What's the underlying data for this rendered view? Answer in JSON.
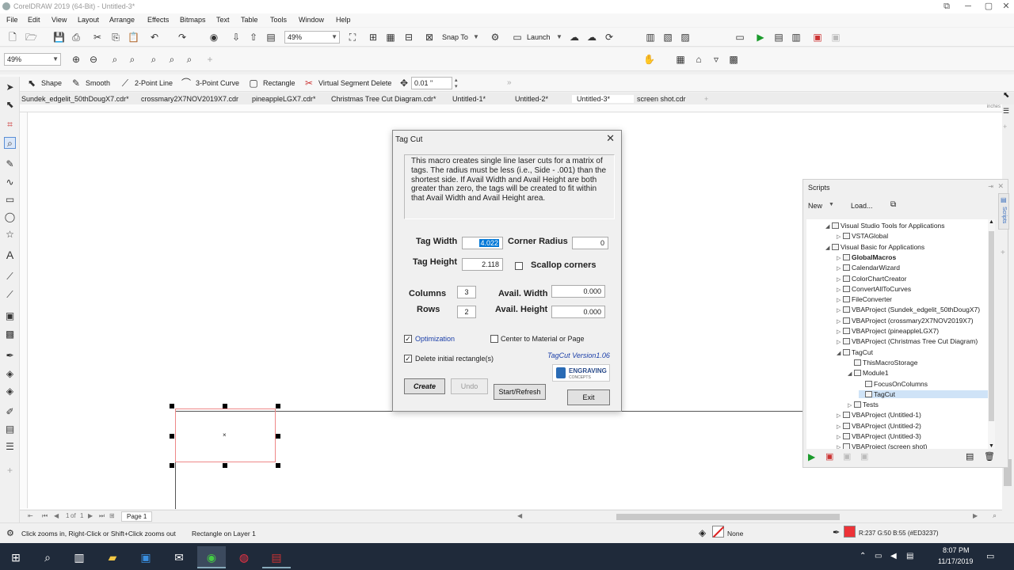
{
  "window": {
    "title": "CorelDRAW 2019 (64-Bit) - Untitled-3*"
  },
  "menu": [
    "File",
    "Edit",
    "View",
    "Layout",
    "Arrange",
    "Effects",
    "Bitmaps",
    "Text",
    "Table",
    "Tools",
    "Window",
    "Help"
  ],
  "standard_toolbar": {
    "zoom": "49%",
    "snap_to": "Snap To",
    "launch": "Launch"
  },
  "property_bar": {
    "zoom": "49%"
  },
  "node_bar": {
    "shape": "Shape",
    "smooth": "Smooth",
    "two_point_line": "2-Point Line",
    "three_point_curve": "3-Point Curve",
    "rectangle": "Rectangle",
    "virtual_segment_delete": "Virtual Segment Delete",
    "nudge": "0.01 \""
  },
  "doc_tabs": [
    "Sundek_edgelit_50thDougX7.cdr*",
    "crossmary2X7NOV2019X7.cdr",
    "pineappleLGX7.cdr*",
    "Christmas Tree Cut Diagram.cdr*",
    "Untitled-1*",
    "Untitled-2*",
    "Untitled-3*",
    "screen shot.cdr"
  ],
  "ruler_unit": "inches",
  "dialog": {
    "title": "Tag Cut",
    "description": "This macro creates single line laser cuts for a matrix of tags.  The radius must be less (i.e., Side - .001) than the shortest side.                                                    If Avail Width and Avail Height are both greater than zero, the tags will be created to fit within that Avail Width and Avail Height area.",
    "tag_width_label": "Tag Width",
    "tag_width_value": "4.022",
    "corner_radius_label": "Corner Radius",
    "corner_radius_value": "0",
    "tag_height_label": "Tag Height",
    "tag_height_value": "2.118",
    "scallop_label": "Scallop corners",
    "columns_label": "Columns",
    "columns_value": "3",
    "rows_label": "Rows",
    "rows_value": "2",
    "avail_width_label": "Avail. Width",
    "avail_width_value": "0.000",
    "avail_height_label": "Avail. Height",
    "avail_height_value": "0.000",
    "optimization_label": "Optimization",
    "center_label": "Center to Material or Page",
    "delete_label": "Delete initial rectangle(s)",
    "version": "TagCut Version1.06",
    "logo_text": "ENGRAVING",
    "logo_sub": "CONCEPTS",
    "create": "Create",
    "undo": "Undo",
    "start_refresh": "Start/Refresh",
    "exit": "Exit"
  },
  "scripts": {
    "title": "Scripts",
    "new": "New",
    "load": "Load...",
    "tab": "Scripts",
    "tree": [
      {
        "label": "Visual Studio Tools for Applications",
        "level": 0,
        "tw": "◢"
      },
      {
        "label": "VSTAGlobal",
        "level": 1,
        "tw": "▷"
      },
      {
        "label": "Visual Basic for Applications",
        "level": 0,
        "tw": "◢"
      },
      {
        "label": "GlobalMacros",
        "level": 1,
        "tw": "▷",
        "bold": true
      },
      {
        "label": "CalendarWizard",
        "level": 1,
        "tw": "▷"
      },
      {
        "label": "ColorChartCreator",
        "level": 1,
        "tw": "▷"
      },
      {
        "label": "ConvertAllToCurves",
        "level": 1,
        "tw": "▷"
      },
      {
        "label": "FileConverter",
        "level": 1,
        "tw": "▷"
      },
      {
        "label": "VBAProject (Sundek_edgelit_50thDougX7)",
        "level": 1,
        "tw": "▷"
      },
      {
        "label": "VBAProject (crossmary2X7NOV2019X7)",
        "level": 1,
        "tw": "▷"
      },
      {
        "label": "VBAProject (pineappleLGX7)",
        "level": 1,
        "tw": "▷"
      },
      {
        "label": "VBAProject (Christmas Tree Cut Diagram)",
        "level": 1,
        "tw": "▷"
      },
      {
        "label": "TagCut",
        "level": 1,
        "tw": "◢"
      },
      {
        "label": "ThisMacroStorage",
        "level": 2,
        "tw": ""
      },
      {
        "label": "Module1",
        "level": 2,
        "tw": "◢"
      },
      {
        "label": "FocusOnColumns",
        "level": 3,
        "tw": ""
      },
      {
        "label": "TagCut",
        "level": 3,
        "tw": "",
        "selected": true
      },
      {
        "label": "Tests",
        "level": 2,
        "tw": "▷"
      },
      {
        "label": "VBAProject (Untitled-1)",
        "level": 1,
        "tw": "▷"
      },
      {
        "label": "VBAProject (Untitled-2)",
        "level": 1,
        "tw": "▷"
      },
      {
        "label": "VBAProject (Untitled-3)",
        "level": 1,
        "tw": "▷"
      },
      {
        "label": "VBAProject (screen shot)",
        "level": 1,
        "tw": "▷"
      }
    ]
  },
  "page_nav": {
    "of": "of",
    "page": "Page 1"
  },
  "status": {
    "hint": "Click zooms in, Right-Click or Shift+Click zooms out",
    "object": "Rectangle on Layer 1",
    "fill": "None",
    "color": "R:237 G:50 B:55 (#ED3237)",
    "swatch_color": "#ED3237"
  },
  "taskbar": {
    "time": "8:07 PM",
    "date": "11/17/2019"
  }
}
